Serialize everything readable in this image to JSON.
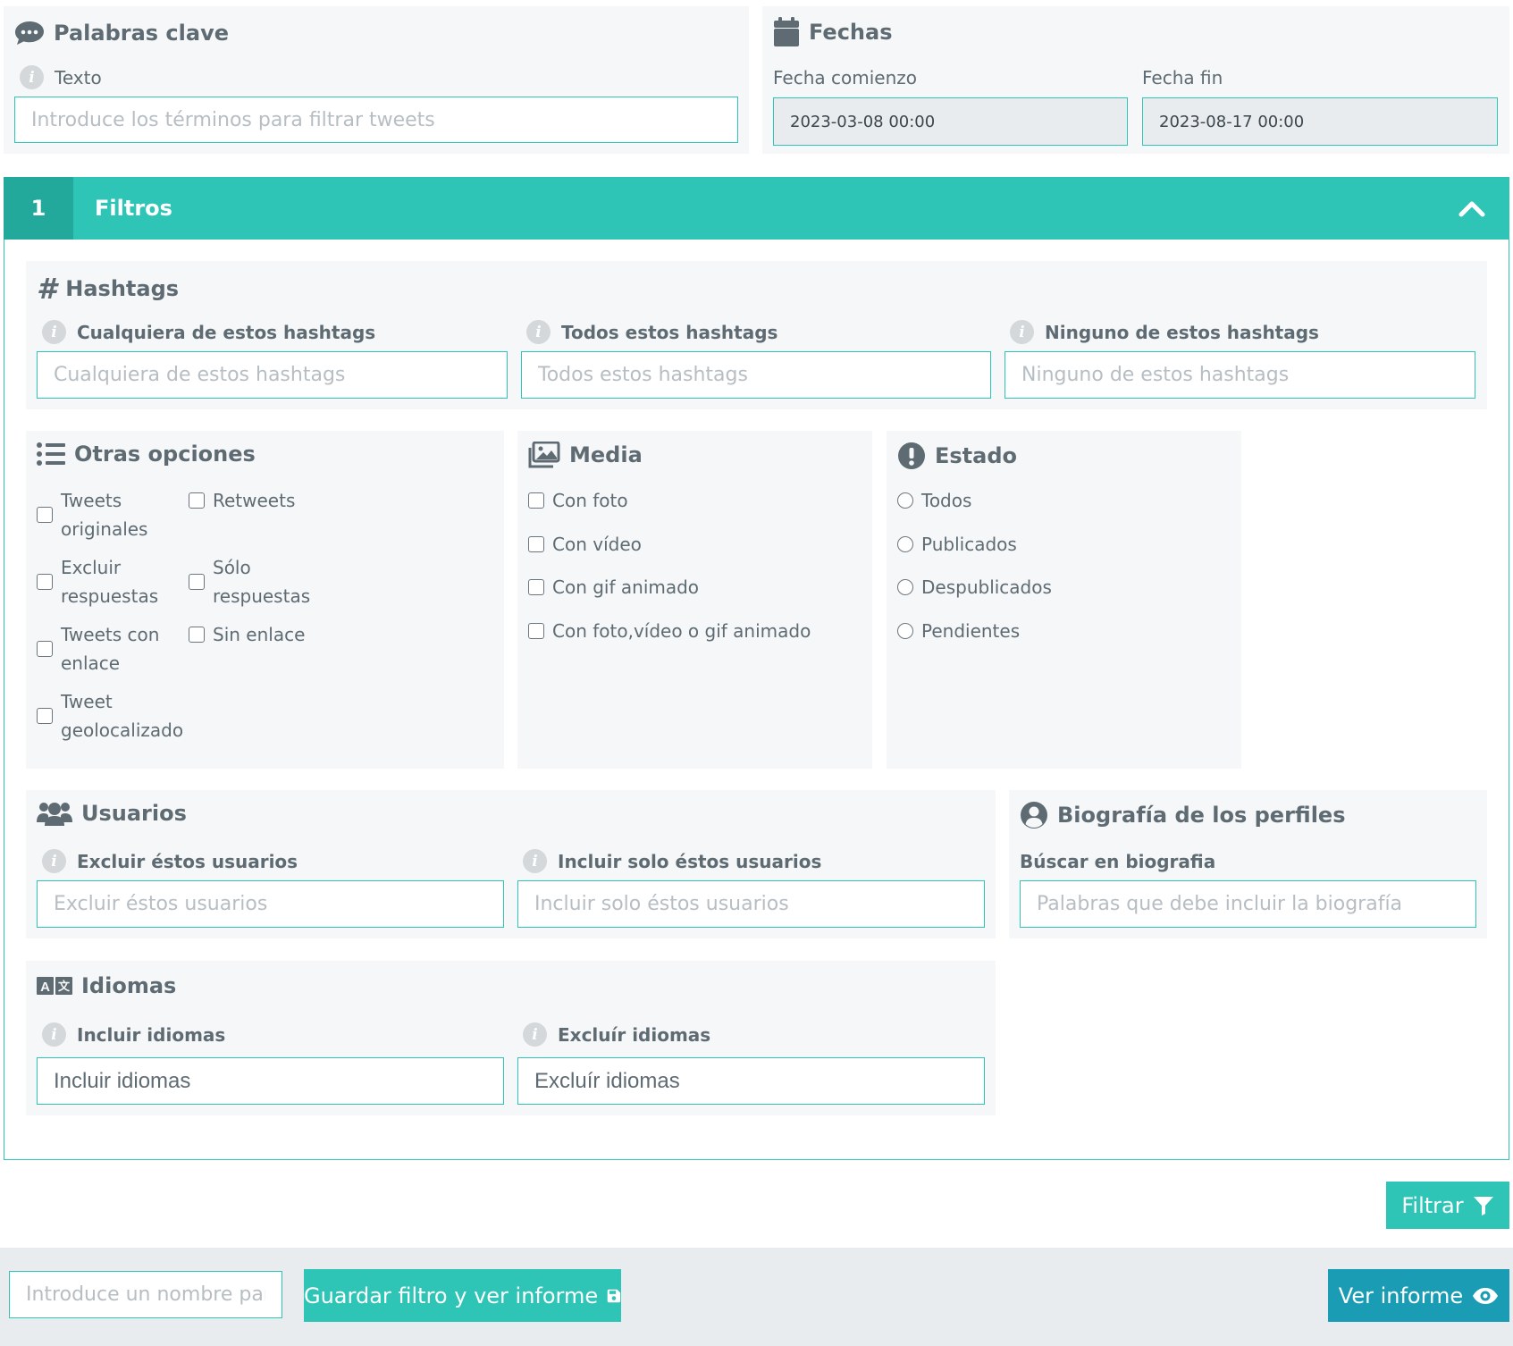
{
  "keywords": {
    "title": "Palabras clave",
    "label": "Texto",
    "placeholder": "Introduce los términos para filtrar tweets"
  },
  "dates": {
    "title": "Fechas",
    "start_label": "Fecha comienzo",
    "start_value": "2023-03-08 00:00",
    "end_label": "Fecha fin",
    "end_value": "2023-08-17 00:00"
  },
  "filters_bar": {
    "number": "1",
    "title": "Filtros"
  },
  "hashtags": {
    "title": "Hashtags",
    "any_label": "Cualquiera de estos hashtags",
    "any_placeholder": "Cualquiera de estos hashtags",
    "all_label": "Todos estos hashtags",
    "all_placeholder": "Todos estos hashtags",
    "none_label": "Ninguno de estos hashtags",
    "none_placeholder": "Ninguno de estos hashtags"
  },
  "other_options": {
    "title": "Otras opciones",
    "items": [
      "Tweets originales",
      "Retweets",
      "Excluir respuestas",
      "Sólo respuestas",
      "Tweets con enlace",
      "Sin enlace",
      "Tweet geolocalizado"
    ]
  },
  "media": {
    "title": "Media",
    "items": [
      "Con foto",
      "Con vídeo",
      "Con gif animado",
      "Con foto,vídeo o gif animado"
    ]
  },
  "status": {
    "title": "Estado",
    "items": [
      "Todos",
      "Publicados",
      "Despublicados",
      "Pendientes"
    ]
  },
  "users": {
    "title": "Usuarios",
    "exclude_label": "Excluir éstos usuarios",
    "exclude_placeholder": "Excluir éstos usuarios",
    "include_label": "Incluir solo éstos usuarios",
    "include_placeholder": "Incluir solo éstos usuarios"
  },
  "bio": {
    "title": "Biografía de los perfiles",
    "label": "Búscar en biografia",
    "placeholder": "Palabras que debe incluir la biografía"
  },
  "languages": {
    "title": "Idiomas",
    "include_label": "Incluir idiomas",
    "include_placeholder": "Incluir idiomas",
    "exclude_label": "Excluír idiomas",
    "exclude_placeholder": "Excluír idiomas"
  },
  "actions": {
    "filter_label": "Filtrar",
    "name_placeholder": "Introduce un nombre para el filtro",
    "save_label": "Guardar filtro y ver informe",
    "report_label": "Ver informe"
  },
  "colors": {
    "accent": "#2ec4b6",
    "accent_dark": "#23a99c",
    "report_button": "#1a9cb5",
    "panel": "#f5f7f8",
    "text": "#5f6b73"
  }
}
